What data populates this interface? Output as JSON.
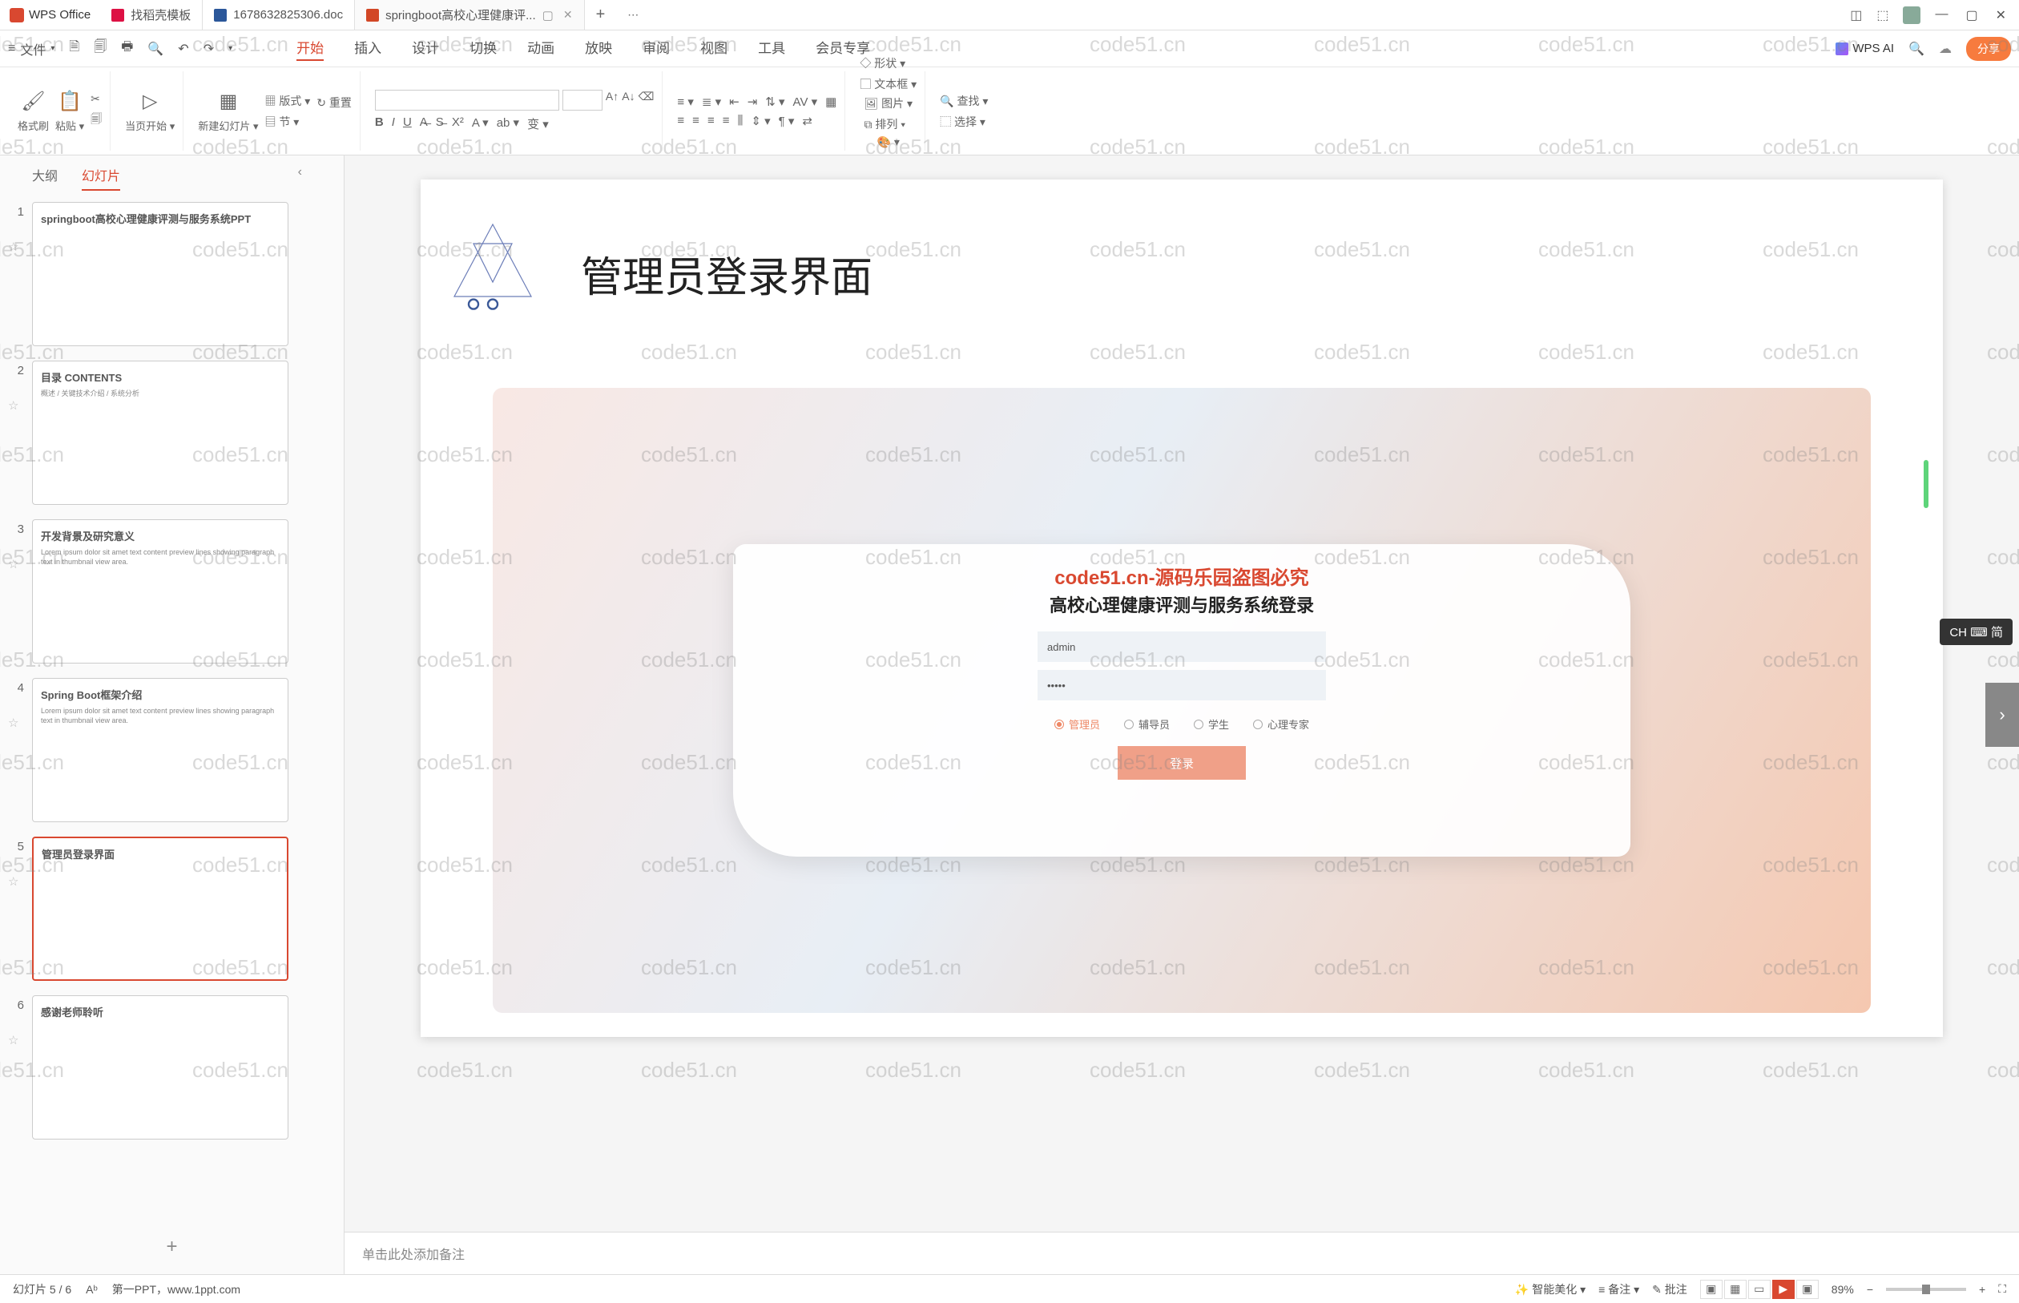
{
  "watermark_text": "code51.cn",
  "app": {
    "name": "WPS Office"
  },
  "tabs": [
    {
      "icon": "red",
      "label": "找稻壳模板"
    },
    {
      "icon": "blue",
      "label": "1678632825306.doc"
    },
    {
      "icon": "orange",
      "label": "springboot高校心理健康评...",
      "active": true
    }
  ],
  "file_menu": "文件",
  "menu": {
    "items": [
      "开始",
      "插入",
      "设计",
      "切换",
      "动画",
      "放映",
      "审阅",
      "视图",
      "工具",
      "会员专享"
    ],
    "active": 0
  },
  "wps_ai": "WPS AI",
  "share": "分享",
  "ribbon": {
    "format_brush": "格式刷",
    "paste": "粘贴",
    "start_current": "当页开始",
    "new_slide": "新建幻灯片",
    "layout": "版式",
    "section": "节",
    "reset": "重置",
    "font_name": "",
    "font_size": "",
    "shape": "形状",
    "picture": "图片",
    "textbox": "文本框",
    "arrange": "排列",
    "find": "查找",
    "select": "选择"
  },
  "sidebar": {
    "tabs": [
      "大纲",
      "幻灯片"
    ],
    "active": 1,
    "slides": [
      {
        "num": "1",
        "title": "springboot高校心理健康评测与服务系统PPT"
      },
      {
        "num": "2",
        "title": "目录 CONTENTS",
        "sub": "概述 / 关键技术介绍 / 系统分析"
      },
      {
        "num": "3",
        "title": "开发背景及研究意义"
      },
      {
        "num": "4",
        "title": "Spring Boot框架介绍"
      },
      {
        "num": "5",
        "title": "管理员登录界面"
      },
      {
        "num": "6",
        "title": "感谢老师聆听"
      }
    ]
  },
  "slide": {
    "title": "管理员登录界面",
    "copyright": "code51.cn-源码乐园盗图必究",
    "login_title": "高校心理健康评测与服务系统登录",
    "username": "admin",
    "password": "•••••",
    "roles": [
      "管理员",
      "辅导员",
      "学生",
      "心理专家"
    ],
    "login_btn": "登录"
  },
  "notes_placeholder": "单击此处添加备注",
  "status": {
    "slide_info": "幻灯片 5 / 6",
    "template": "第一PPT，www.1ppt.com",
    "beautify": "智能美化",
    "notes": "备注",
    "review": "批注",
    "zoom": "89%"
  },
  "ime": "CH ⌨ 简"
}
